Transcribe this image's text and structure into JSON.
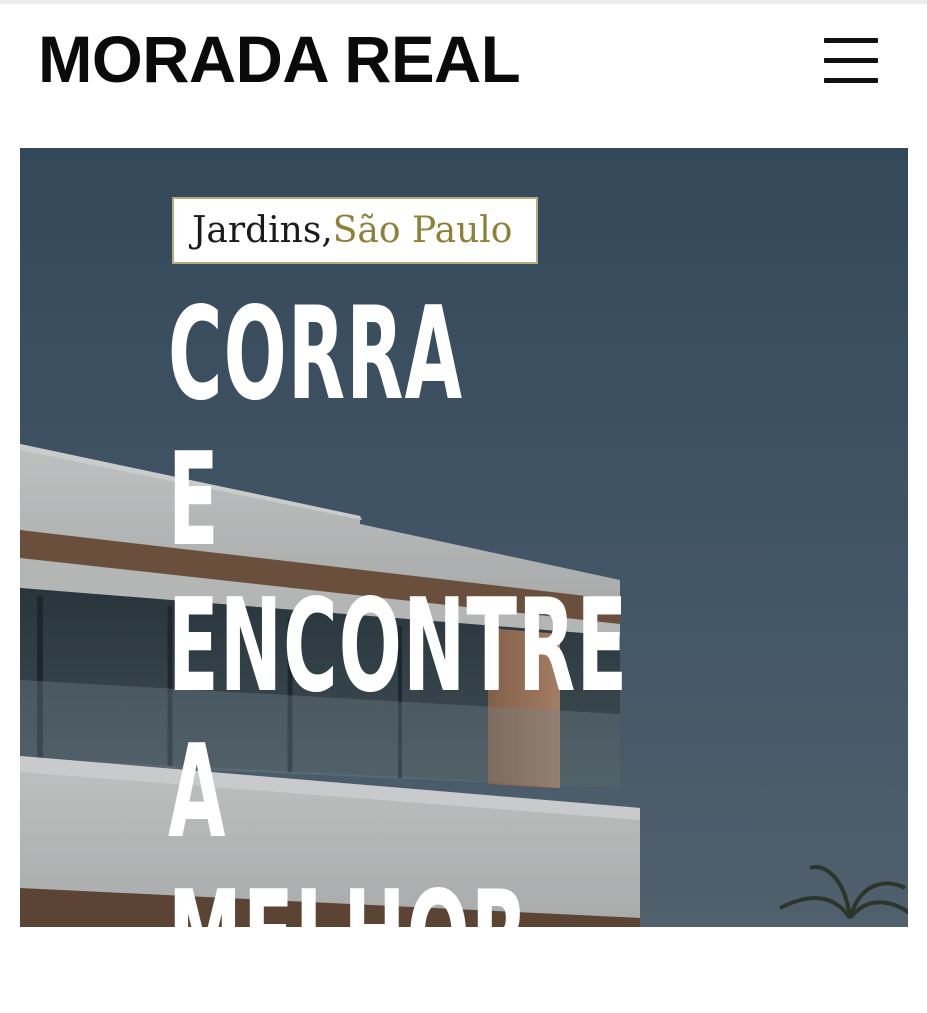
{
  "header": {
    "brand": "MORADA REAL",
    "menu_icon": "hamburger-menu-icon"
  },
  "hero": {
    "location": {
      "district": "Jardins,",
      "city": "São Paulo"
    },
    "headline_lines": [
      "CORRA",
      "E",
      "ENCONTRE",
      "A",
      "MELHOR"
    ],
    "background_image": "modern white house with wooden accents and glass balcony under cloudy sky"
  },
  "colors": {
    "accent_gold": "#8d8137",
    "tag_border": "#b7ad7b",
    "sky": "#4a5f70",
    "text_dark": "#0a0a0a"
  }
}
